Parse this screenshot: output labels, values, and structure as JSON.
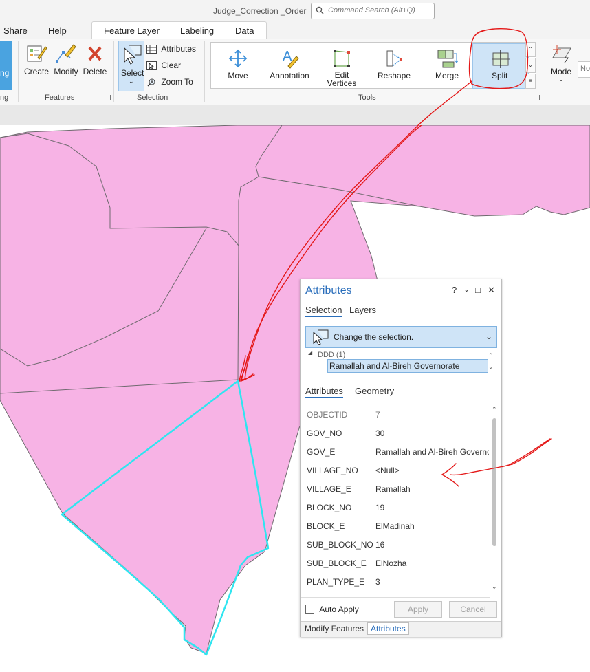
{
  "window": {
    "title": "Judge_Correction _Order",
    "command_search_placeholder": "Command Search (Alt+Q)"
  },
  "tabs": {
    "share": "Share",
    "help": "Help",
    "feature_layer": "Feature Layer",
    "labeling": "Labeling",
    "data": "Data"
  },
  "ribbon": {
    "cut_label": "ng",
    "features": {
      "group_label": "Features",
      "create": "Create",
      "modify": "Modify",
      "delete": "Delete"
    },
    "selection": {
      "group_label": "Selection",
      "select": "Select",
      "attributes": "Attributes",
      "clear": "Clear",
      "zoom_to": "Zoom To"
    },
    "tools": {
      "group_label": "Tools",
      "move": "Move",
      "annotation": "Annotation",
      "edit_vertices_1": "Edit",
      "edit_vertices_2": "Vertices",
      "reshape": "Reshape",
      "merge": "Merge",
      "split": "Split"
    },
    "mode": {
      "label": "Mode",
      "cut_field": "No"
    },
    "group_cut_label": "ng"
  },
  "colors": {
    "polygon_fill": "#f7b3e5",
    "polygon_stroke": "#6f6a6f",
    "selection": "#2fe5f0",
    "annotation_ink": "#e41818",
    "accent": "#2a6ebb"
  },
  "attributes_pane": {
    "title": "Attributes",
    "help": "?",
    "tab_selection": "Selection",
    "tab_layers": "Layers",
    "change_selection": "Change the selection.",
    "tree_layer": "DDD (1)",
    "tree_feature": "Ramallah and Al-Bireh Governorate",
    "tab_attributes": "Attributes",
    "tab_geometry": "Geometry",
    "rows": [
      {
        "field": "OBJECTID",
        "value": "7"
      },
      {
        "field": "GOV_NO",
        "value": "30"
      },
      {
        "field": "GOV_E",
        "value": "Ramallah and Al-Bireh Governo"
      },
      {
        "field": "VILLAGE_NO",
        "value": "<Null>"
      },
      {
        "field": "VILLAGE_E",
        "value": "Ramallah"
      },
      {
        "field": "BLOCK_NO",
        "value": "19"
      },
      {
        "field": "BLOCK_E",
        "value": "ElMadinah"
      },
      {
        "field": "SUB_BLOCK_NO",
        "value": "16"
      },
      {
        "field": "SUB_BLOCK_E",
        "value": "ElNozha"
      },
      {
        "field": "PLAN_TYPE_E",
        "value": "3"
      }
    ],
    "auto_apply": "Auto Apply",
    "apply": "Apply",
    "cancel": "Cancel",
    "bottom_tab_modify": "Modify Features",
    "bottom_tab_attributes": "Attributes"
  }
}
